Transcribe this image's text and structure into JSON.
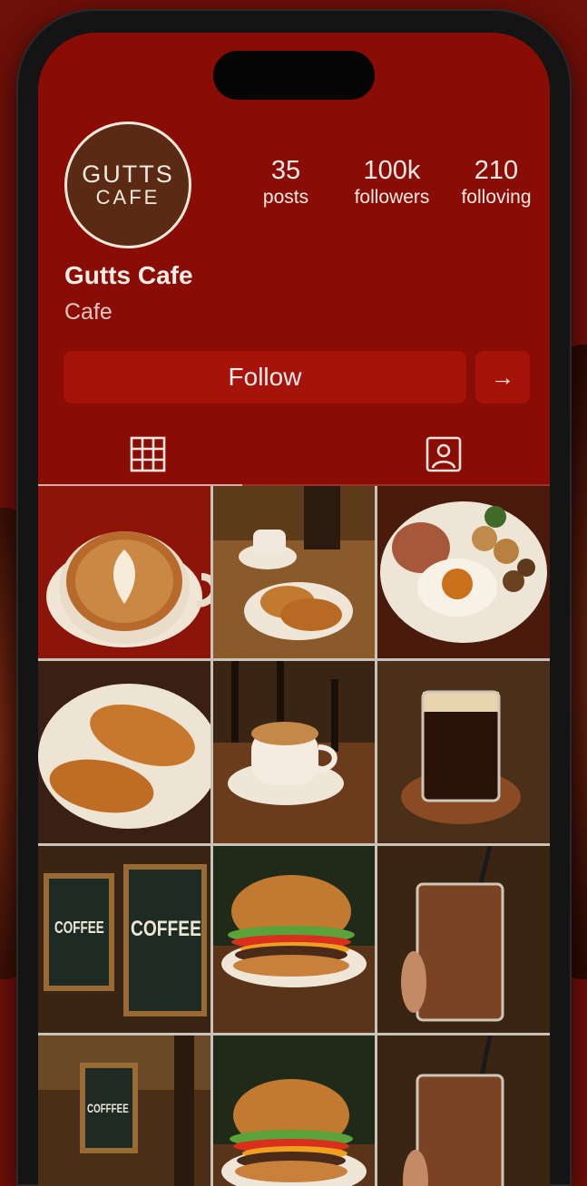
{
  "profile": {
    "avatar_line1": "GUTTS",
    "avatar_line2": "CAFE",
    "name": "Gutts Cafe",
    "category": "Cafe"
  },
  "stats": {
    "posts": {
      "value": "35",
      "label": "posts"
    },
    "followers": {
      "value": "100k",
      "label": "followers"
    },
    "following": {
      "value": "210",
      "label": "folloving"
    }
  },
  "actions": {
    "follow_label": "Follow",
    "arrow_label": "→"
  },
  "tabs": [
    {
      "icon": "grid-icon",
      "active": true
    },
    {
      "icon": "tagged-icon",
      "active": false
    }
  ],
  "posts": [
    {
      "subject": "latte-art-cup"
    },
    {
      "subject": "coffee-and-croissants"
    },
    {
      "subject": "breakfast-plate"
    },
    {
      "subject": "croissants-plate"
    },
    {
      "subject": "coffee-cup"
    },
    {
      "subject": "iced-americano"
    },
    {
      "subject": "coffee-signs",
      "sign_text": "COFFEE"
    },
    {
      "subject": "burger"
    },
    {
      "subject": "iced-latte"
    },
    {
      "subject": "coffee-sign",
      "sign_text": "COFFFEE"
    },
    {
      "subject": "burger"
    },
    {
      "subject": "iced-latte"
    }
  ],
  "colors": {
    "screen_bg": "#8a0d05",
    "button_bg": "#a6130a",
    "avatar_bg": "#5a2a14"
  }
}
